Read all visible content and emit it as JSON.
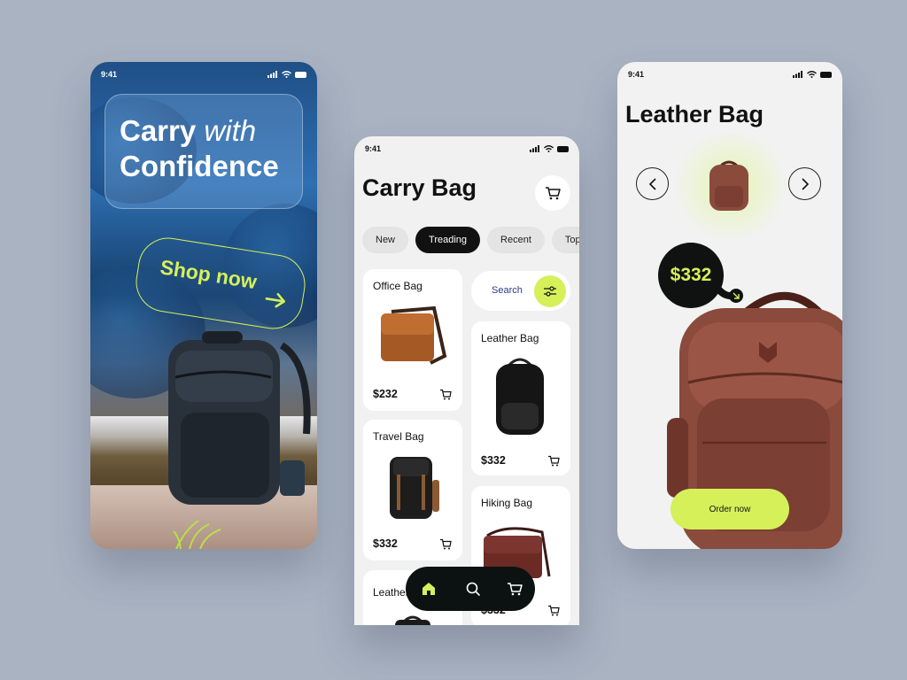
{
  "status": {
    "time": "9:41"
  },
  "splash": {
    "title_word1": "Carry",
    "title_word2": "with",
    "title_line2": "Confidence",
    "shop_button": "Shop now"
  },
  "catalog": {
    "title": "Carry Bag",
    "tabs": [
      {
        "label": "New",
        "active": false
      },
      {
        "label": "Treading",
        "active": true
      },
      {
        "label": "Recent",
        "active": false
      },
      {
        "label": "Top",
        "active": false
      }
    ],
    "search_label": "Search",
    "products": [
      {
        "name": "Office Bag",
        "price": "$232"
      },
      {
        "name": "Leather  Bag",
        "price": "$332"
      },
      {
        "name": "Travel  Bag",
        "price": "$332"
      },
      {
        "name": "Hiking  Bag",
        "price": "$332"
      },
      {
        "name": "Leather",
        "price": ""
      }
    ],
    "nav_items": [
      "home-icon",
      "search-icon",
      "cart-icon"
    ]
  },
  "detail": {
    "title": "Leather Bag",
    "price": "$332",
    "order_button": "Order now"
  },
  "colors": {
    "accent": "#d6f05a",
    "dark": "#0f1211",
    "background": "#a9b3c2",
    "leather": "#8a4a3c"
  }
}
